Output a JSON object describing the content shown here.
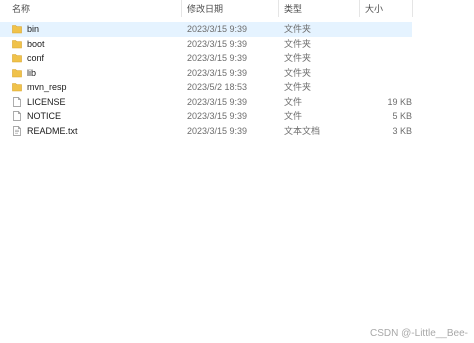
{
  "columns": {
    "name": "名称",
    "date": "修改日期",
    "type": "类型",
    "size": "大小"
  },
  "files": [
    {
      "name": "bin",
      "date": "2023/3/15 9:39",
      "type": "文件夹",
      "size": "",
      "icon": "folder-icon",
      "selected": true
    },
    {
      "name": "boot",
      "date": "2023/3/15 9:39",
      "type": "文件夹",
      "size": "",
      "icon": "folder-icon"
    },
    {
      "name": "conf",
      "date": "2023/3/15 9:39",
      "type": "文件夹",
      "size": "",
      "icon": "folder-icon"
    },
    {
      "name": "lib",
      "date": "2023/3/15 9:39",
      "type": "文件夹",
      "size": "",
      "icon": "folder-icon"
    },
    {
      "name": "mvn_resp",
      "date": "2023/5/2 18:53",
      "type": "文件夹",
      "size": "",
      "icon": "folder-icon"
    },
    {
      "name": "LICENSE",
      "date": "2023/3/15 9:39",
      "type": "文件",
      "size": "19 KB",
      "icon": "file-icon"
    },
    {
      "name": "NOTICE",
      "date": "2023/3/15 9:39",
      "type": "文件",
      "size": "5 KB",
      "icon": "file-icon"
    },
    {
      "name": "README.txt",
      "date": "2023/3/15 9:39",
      "type": "文本文档",
      "size": "3 KB",
      "icon": "text-file-icon"
    }
  ],
  "watermark": "CSDN @-Little__Bee-",
  "colors": {
    "selected_row": "#e5f3ff",
    "folder": "#f0c24a"
  }
}
